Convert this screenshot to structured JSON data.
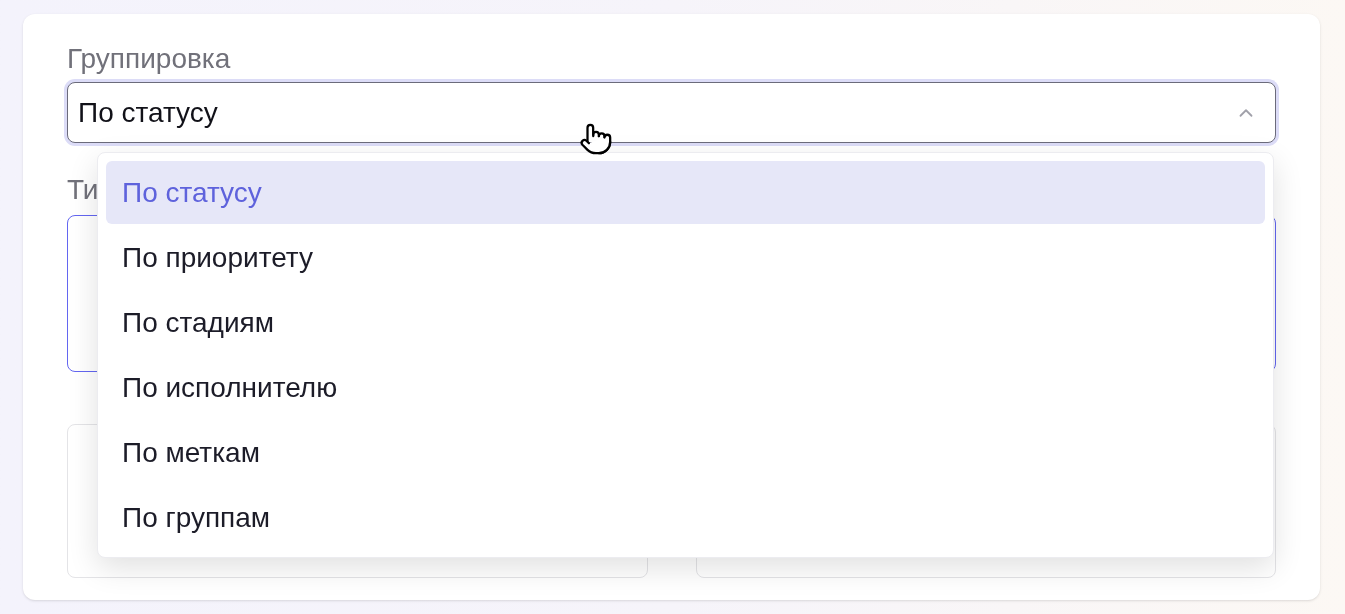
{
  "grouping": {
    "label": "Группировка",
    "value": "По статусу",
    "expanded": true,
    "options": [
      {
        "label": "По статусу",
        "selected": true
      },
      {
        "label": "По приоритету",
        "selected": false
      },
      {
        "label": "По стадиям",
        "selected": false
      },
      {
        "label": "По исполнителю",
        "selected": false
      },
      {
        "label": "По меткам",
        "selected": false
      },
      {
        "label": "По группам",
        "selected": false
      }
    ]
  },
  "type_field": {
    "label": "Ти"
  }
}
